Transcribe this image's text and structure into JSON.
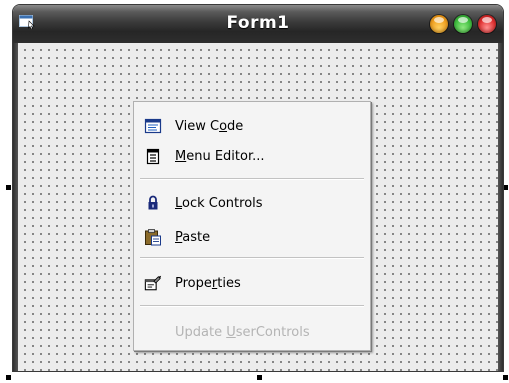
{
  "window": {
    "title": "Form1"
  },
  "context_menu": {
    "items": [
      {
        "label_pre": "View C",
        "label_ul": "o",
        "label_post": "de",
        "icon": "view-code-icon",
        "enabled": true
      },
      {
        "label_pre": "",
        "label_ul": "M",
        "label_post": "enu Editor...",
        "icon": "menu-editor-icon",
        "enabled": true
      },
      {
        "label_pre": "",
        "label_ul": "L",
        "label_post": "ock Controls",
        "icon": "lock-icon",
        "enabled": true
      },
      {
        "label_pre": "",
        "label_ul": "P",
        "label_post": "aste",
        "icon": "paste-icon",
        "enabled": true
      },
      {
        "label_pre": "Prope",
        "label_ul": "r",
        "label_post": "ties",
        "icon": "properties-icon",
        "enabled": true
      },
      {
        "label_pre": "Update ",
        "label_ul": "U",
        "label_post": "serControls",
        "icon": "",
        "enabled": false
      }
    ]
  },
  "colors": {
    "titlebar": "#2e2e2e",
    "form_background": "#ececec",
    "menu_background": "#f4f4f4",
    "disabled_text": "#b4b4b4"
  }
}
